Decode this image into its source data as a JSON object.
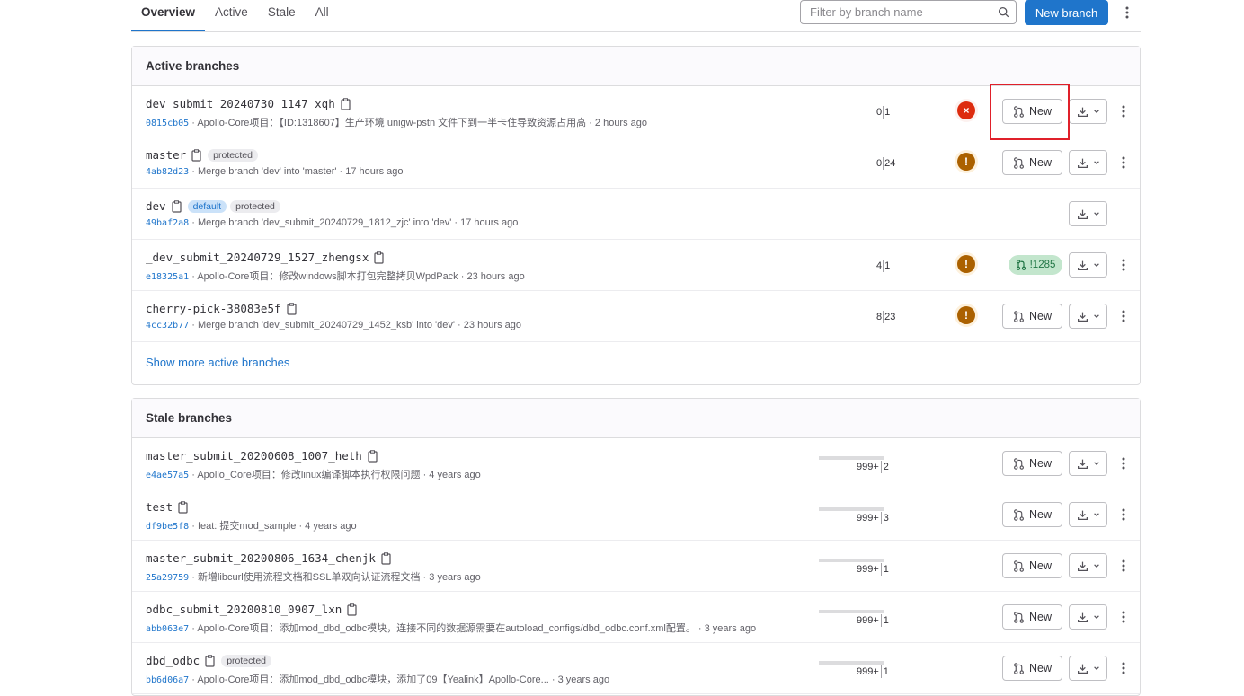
{
  "tabs": [
    "Overview",
    "Active",
    "Stale",
    "All"
  ],
  "search": {
    "placeholder": "Filter by branch name"
  },
  "new_branch_label": "New branch",
  "active": {
    "title": "Active branches",
    "rows": [
      {
        "name": "dev_submit_20240730_1147_xqh",
        "sha": "0815cb05",
        "message": "Apollo-Core项目：【ID:1318607】生产环境 unigw-pstn 文件下到一半卡住导致资源占用高",
        "time": "2 hours ago",
        "behind": "0",
        "ahead": "1",
        "status": "failed",
        "action": "New"
      },
      {
        "name": "master",
        "badges": [
          "protected"
        ],
        "sha": "4ab82d23",
        "message": "Merge branch 'dev' into 'master'",
        "time": "17 hours ago",
        "behind": "0",
        "ahead": "24",
        "status": "warning",
        "action": "New"
      },
      {
        "name": "dev",
        "badges": [
          "default",
          "protected"
        ],
        "sha": "49baf2a8",
        "message": "Merge branch 'dev_submit_20240729_1812_zjc' into 'dev'",
        "time": "17 hours ago"
      },
      {
        "name": "_dev_submit_20240729_1527_zhengsx",
        "sha": "e18325a1",
        "message": "Apollo-Core项目：修改windows脚本打包完整拷贝WpdPack",
        "time": "23 hours ago",
        "behind": "4",
        "ahead": "1",
        "status": "warning",
        "mr": "!1285"
      },
      {
        "name": "cherry-pick-38083e5f",
        "sha": "4cc32b77",
        "message": "Merge branch 'dev_submit_20240729_1452_ksb' into 'dev'",
        "time": "23 hours ago",
        "behind": "8",
        "ahead": "23",
        "status": "warning",
        "action": "New"
      }
    ],
    "show_more": "Show more active branches"
  },
  "stale": {
    "title": "Stale branches",
    "rows": [
      {
        "name": "master_submit_20200608_1007_heth",
        "sha": "e4ae57a5",
        "message": "Apollo_Core项目：修改linux编译脚本执行权限问题",
        "time": "4 years ago",
        "behind": "999+",
        "ahead": "2",
        "action": "New"
      },
      {
        "name": "test",
        "sha": "df9be5f8",
        "message": "feat: 提交mod_sample",
        "time": "4 years ago",
        "behind": "999+",
        "ahead": "3",
        "action": "New"
      },
      {
        "name": "master_submit_20200806_1634_chenjk",
        "sha": "25a29759",
        "message": "新增libcurl使用流程文档和SSL单双向认证流程文档",
        "time": "3 years ago",
        "behind": "999+",
        "ahead": "1",
        "action": "New"
      },
      {
        "name": "odbc_submit_20200810_0907_lxn",
        "sha": "abb063e7",
        "message": "Apollo-Core项目：添加mod_dbd_odbc模块，连接不同的数据源需要在autoload_configs/dbd_odbc.conf.xml配置。",
        "time": "3 years ago",
        "behind": "999+",
        "ahead": "1",
        "action": "New"
      },
      {
        "name": "dbd_odbc",
        "badges": [
          "protected"
        ],
        "sha": "bb6d06a7",
        "message": "Apollo-Core项目：添加mod_dbd_odbc模块，添加了09【Yealink】Apollo-Core...",
        "time": "3 years ago",
        "behind": "999+",
        "ahead": "1",
        "action": "New"
      }
    ]
  }
}
